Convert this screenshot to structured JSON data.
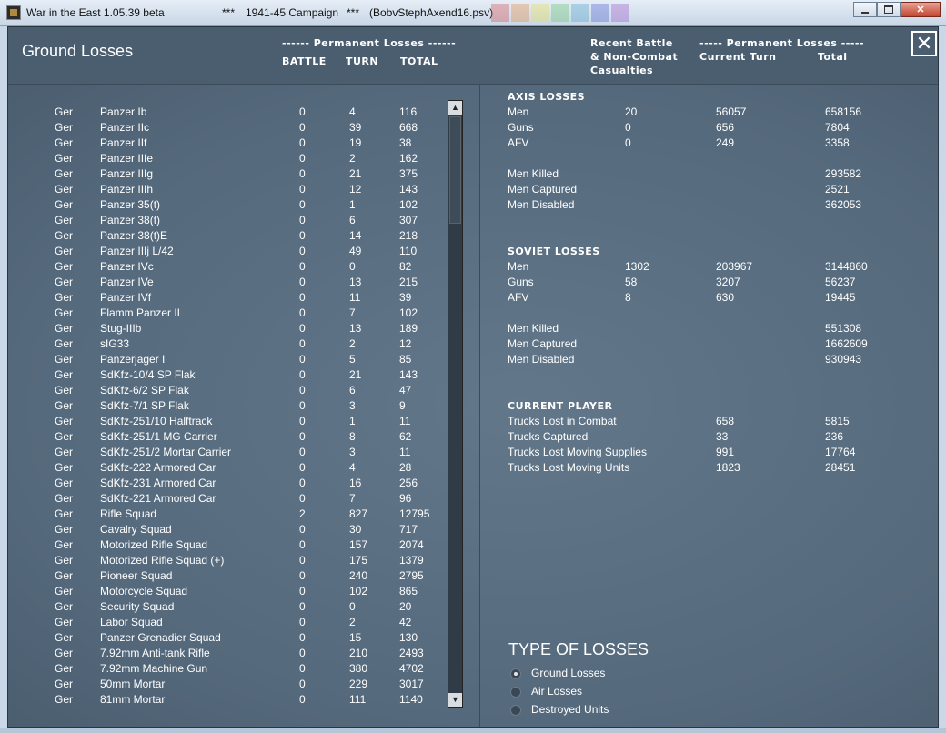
{
  "window": {
    "title": "War in the East 1.05.39 beta",
    "sep1": "***",
    "campaign": "1941-45 Campaign",
    "sep2": "***",
    "file": "(BobvStephAxend16.psv)",
    "colors": [
      "#d84b4b",
      "#e58a3a",
      "#e8e04a",
      "#62c46a",
      "#4aa2c8",
      "#4a5ed0",
      "#9a54c8"
    ]
  },
  "header": {
    "title": "Ground Losses",
    "perm_losses": "------ Permanent Losses ------",
    "col_battle": "BATTLE",
    "col_turn": "TURN",
    "col_total": "TOTAL",
    "recent_1": "Recent Battle",
    "recent_2": "& Non-Combat",
    "recent_3": "Casualties",
    "perm_losses_right": "----- Permanent Losses -----",
    "current_turn": "Current Turn",
    "total": "Total",
    "close": "✕"
  },
  "units": [
    {
      "nat": "Ger",
      "name": "Panzer Ib",
      "battle": "0",
      "turn": "4",
      "total": "116"
    },
    {
      "nat": "Ger",
      "name": "Panzer IIc",
      "battle": "0",
      "turn": "39",
      "total": "668"
    },
    {
      "nat": "Ger",
      "name": "Panzer IIf",
      "battle": "0",
      "turn": "19",
      "total": "38"
    },
    {
      "nat": "Ger",
      "name": "Panzer IIIe",
      "battle": "0",
      "turn": "2",
      "total": "162"
    },
    {
      "nat": "Ger",
      "name": "Panzer IIIg",
      "battle": "0",
      "turn": "21",
      "total": "375"
    },
    {
      "nat": "Ger",
      "name": "Panzer IIIh",
      "battle": "0",
      "turn": "12",
      "total": "143"
    },
    {
      "nat": "Ger",
      "name": "Panzer 35(t)",
      "battle": "0",
      "turn": "1",
      "total": "102"
    },
    {
      "nat": "Ger",
      "name": "Panzer 38(t)",
      "battle": "0",
      "turn": "6",
      "total": "307"
    },
    {
      "nat": "Ger",
      "name": "Panzer 38(t)E",
      "battle": "0",
      "turn": "14",
      "total": "218"
    },
    {
      "nat": "Ger",
      "name": "Panzer IIIj L/42",
      "battle": "0",
      "turn": "49",
      "total": "110"
    },
    {
      "nat": "Ger",
      "name": "Panzer IVc",
      "battle": "0",
      "turn": "0",
      "total": "82"
    },
    {
      "nat": "Ger",
      "name": "Panzer IVe",
      "battle": "0",
      "turn": "13",
      "total": "215"
    },
    {
      "nat": "Ger",
      "name": "Panzer IVf",
      "battle": "0",
      "turn": "11",
      "total": "39"
    },
    {
      "nat": "Ger",
      "name": "Flamm Panzer II",
      "battle": "0",
      "turn": "7",
      "total": "102"
    },
    {
      "nat": "Ger",
      "name": "Stug-IIIb",
      "battle": "0",
      "turn": "13",
      "total": "189"
    },
    {
      "nat": "Ger",
      "name": "sIG33",
      "battle": "0",
      "turn": "2",
      "total": "12"
    },
    {
      "nat": "Ger",
      "name": "Panzerjager I",
      "battle": "0",
      "turn": "5",
      "total": "85"
    },
    {
      "nat": "Ger",
      "name": "SdKfz-10/4 SP Flak",
      "battle": "0",
      "turn": "21",
      "total": "143"
    },
    {
      "nat": "Ger",
      "name": "SdKfz-6/2 SP Flak",
      "battle": "0",
      "turn": "6",
      "total": "47"
    },
    {
      "nat": "Ger",
      "name": "SdKfz-7/1 SP Flak",
      "battle": "0",
      "turn": "3",
      "total": "9"
    },
    {
      "nat": "Ger",
      "name": "SdKfz-251/10 Halftrack",
      "battle": "0",
      "turn": "1",
      "total": "11"
    },
    {
      "nat": "Ger",
      "name": "SdKfz-251/1 MG Carrier",
      "battle": "0",
      "turn": "8",
      "total": "62"
    },
    {
      "nat": "Ger",
      "name": "SdKfz-251/2 Mortar Carrier",
      "battle": "0",
      "turn": "3",
      "total": "11"
    },
    {
      "nat": "Ger",
      "name": "SdKfz-222 Armored Car",
      "battle": "0",
      "turn": "4",
      "total": "28"
    },
    {
      "nat": "Ger",
      "name": "SdKfz-231 Armored Car",
      "battle": "0",
      "turn": "16",
      "total": "256"
    },
    {
      "nat": "Ger",
      "name": "SdKfz-221 Armored Car",
      "battle": "0",
      "turn": "7",
      "total": "96"
    },
    {
      "nat": "Ger",
      "name": "Rifle Squad",
      "battle": "2",
      "turn": "827",
      "total": "12795"
    },
    {
      "nat": "Ger",
      "name": "Cavalry Squad",
      "battle": "0",
      "turn": "30",
      "total": "717"
    },
    {
      "nat": "Ger",
      "name": "Motorized Rifle Squad",
      "battle": "0",
      "turn": "157",
      "total": "2074"
    },
    {
      "nat": "Ger",
      "name": "Motorized Rifle Squad (+)",
      "battle": "0",
      "turn": "175",
      "total": "1379"
    },
    {
      "nat": "Ger",
      "name": "Pioneer Squad",
      "battle": "0",
      "turn": "240",
      "total": "2795"
    },
    {
      "nat": "Ger",
      "name": "Motorcycle Squad",
      "battle": "0",
      "turn": "102",
      "total": "865"
    },
    {
      "nat": "Ger",
      "name": "Security Squad",
      "battle": "0",
      "turn": "0",
      "total": "20"
    },
    {
      "nat": "Ger",
      "name": "Labor Squad",
      "battle": "0",
      "turn": "2",
      "total": "42"
    },
    {
      "nat": "Ger",
      "name": "Panzer Grenadier Squad",
      "battle": "0",
      "turn": "15",
      "total": "130"
    },
    {
      "nat": "Ger",
      "name": "7.92mm Anti-tank Rifle",
      "battle": "0",
      "turn": "210",
      "total": "2493"
    },
    {
      "nat": "Ger",
      "name": "7.92mm Machine Gun",
      "battle": "0",
      "turn": "380",
      "total": "4702"
    },
    {
      "nat": "Ger",
      "name": "50mm Mortar",
      "battle": "0",
      "turn": "229",
      "total": "3017"
    },
    {
      "nat": "Ger",
      "name": "81mm Mortar",
      "battle": "0",
      "turn": "111",
      "total": "1140"
    }
  ],
  "axis": {
    "title": "AXIS LOSSES",
    "rows": [
      {
        "label": "Men",
        "battle": "20",
        "turn": "56057",
        "total": "658156"
      },
      {
        "label": "Guns",
        "battle": "0",
        "turn": "656",
        "total": "7804"
      },
      {
        "label": "AFV",
        "battle": "0",
        "turn": "249",
        "total": "3358"
      }
    ],
    "rows2": [
      {
        "label": "Men Killed",
        "total": "293582"
      },
      {
        "label": "Men Captured",
        "total": "2521"
      },
      {
        "label": "Men Disabled",
        "total": "362053"
      }
    ]
  },
  "soviet": {
    "title": "SOVIET LOSSES",
    "rows": [
      {
        "label": "Men",
        "battle": "1302",
        "turn": "203967",
        "total": "3144860"
      },
      {
        "label": "Guns",
        "battle": "58",
        "turn": "3207",
        "total": "56237"
      },
      {
        "label": "AFV",
        "battle": "8",
        "turn": "630",
        "total": "19445"
      }
    ],
    "rows2": [
      {
        "label": "Men Killed",
        "total": "551308"
      },
      {
        "label": "Men Captured",
        "total": "1662609"
      },
      {
        "label": "Men Disabled",
        "total": "930943"
      }
    ]
  },
  "player": {
    "title": "CURRENT PLAYER",
    "rows": [
      {
        "label": "Trucks Lost in Combat",
        "turn": "658",
        "total": "5815"
      },
      {
        "label": "Trucks Captured",
        "turn": "33",
        "total": "236"
      },
      {
        "label": "Trucks Lost Moving Supplies",
        "turn": "991",
        "total": "17764"
      },
      {
        "label": "Trucks Lost Moving Units",
        "turn": "1823",
        "total": "28451"
      }
    ]
  },
  "type_of_losses": {
    "title": "TYPE OF LOSSES",
    "options": [
      {
        "label": "Ground Losses",
        "selected": true
      },
      {
        "label": "Air Losses",
        "selected": false
      },
      {
        "label": "Destroyed Units",
        "selected": false
      }
    ]
  }
}
